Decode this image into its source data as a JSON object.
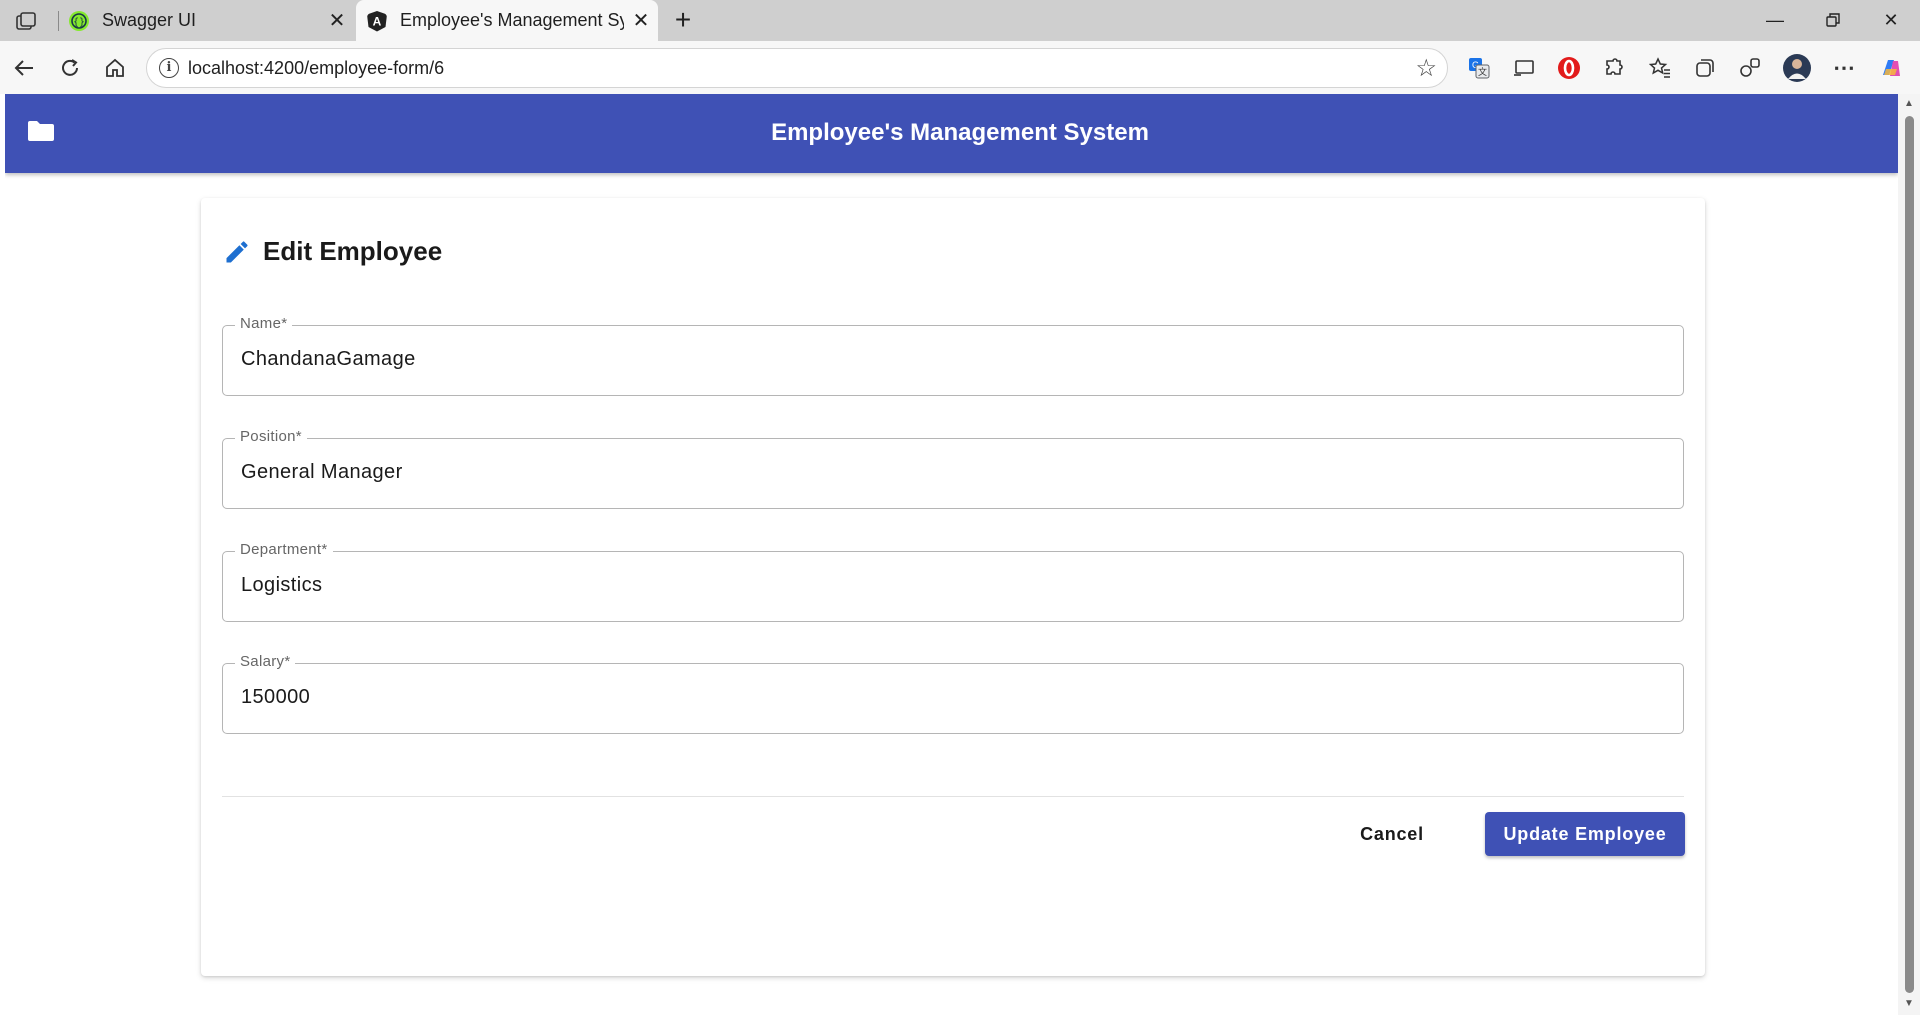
{
  "browser": {
    "tabs": [
      {
        "title": "Swagger UI",
        "favicon": "swagger-icon",
        "active": false
      },
      {
        "title": "Employee's Management System",
        "favicon": "angular-icon",
        "active": true
      }
    ],
    "url": "localhost:4200/employee-form/6"
  },
  "app": {
    "title": "Employee's Management System",
    "accent_color": "#3f51b5"
  },
  "form": {
    "heading": "Edit Employee",
    "fields": [
      {
        "label": "Name*",
        "value": "ChandanaGamage"
      },
      {
        "label": "Position*",
        "value": "General Manager"
      },
      {
        "label": "Department*",
        "value": "Logistics"
      },
      {
        "label": "Salary*",
        "value": "150000"
      }
    ],
    "cancel_label": "Cancel",
    "submit_label": "Update Employee"
  }
}
